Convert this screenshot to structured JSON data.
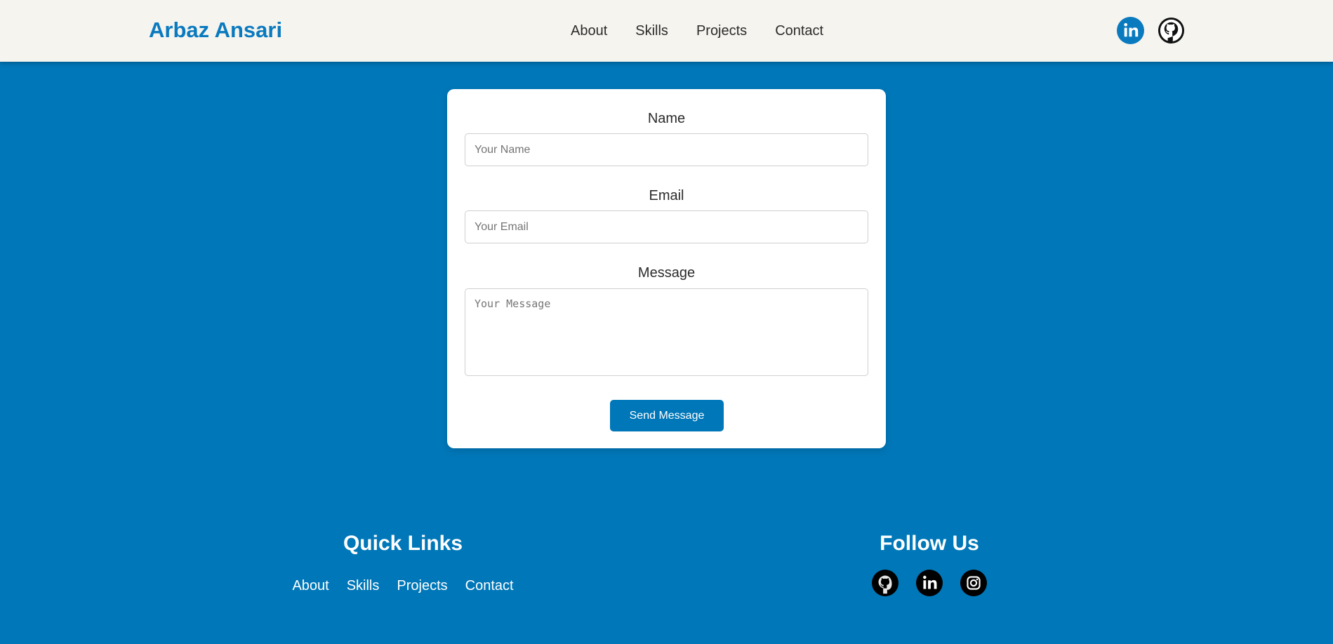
{
  "header": {
    "brand": "Arbaz Ansari",
    "nav": [
      "About",
      "Skills",
      "Projects",
      "Contact"
    ],
    "social_icons": [
      "linkedin-icon",
      "github-icon"
    ]
  },
  "form": {
    "name_label": "Name",
    "name_placeholder": "Your Name",
    "email_label": "Email",
    "email_placeholder": "Your Email",
    "message_label": "Message",
    "message_placeholder": "Your Message",
    "submit_label": "Send Message"
  },
  "footer": {
    "quick_links_title": "Quick Links",
    "quick_links": [
      "About",
      "Skills",
      "Projects",
      "Contact"
    ],
    "follow_title": "Follow Us",
    "follow_icons": [
      "github-icon",
      "linkedin-icon",
      "instagram-icon"
    ]
  },
  "colors": {
    "background": "#0077b8",
    "header_bg": "#f6f4ef",
    "brand": "#0a7abf",
    "button": "#0077b8"
  }
}
